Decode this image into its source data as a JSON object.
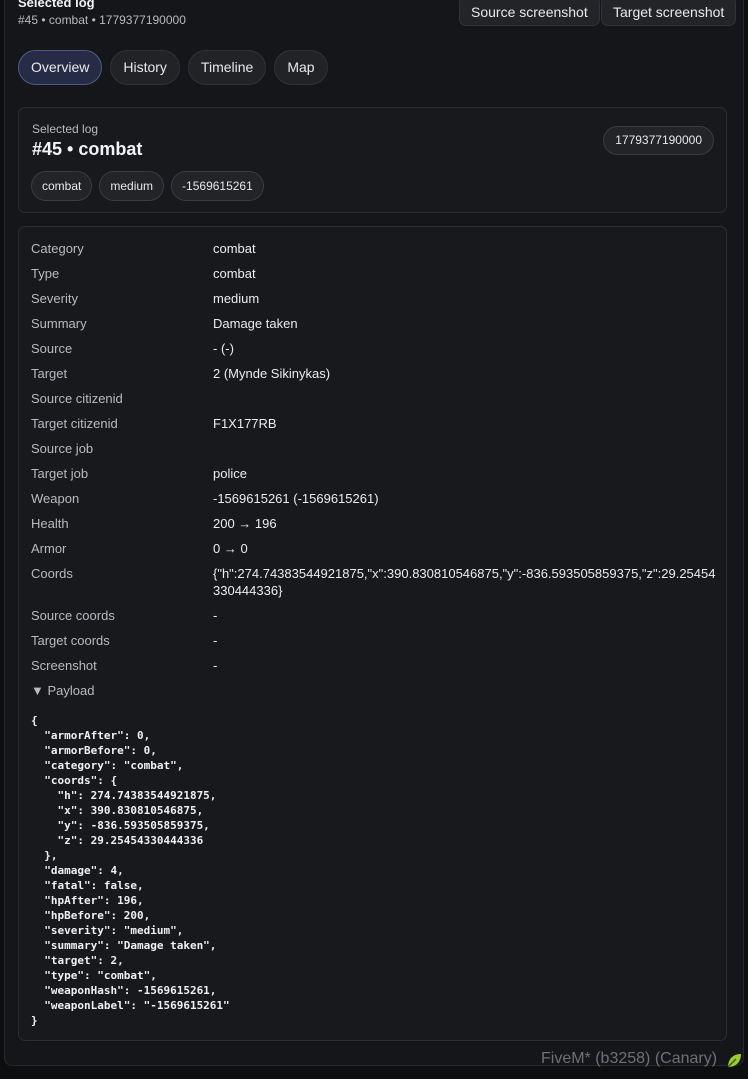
{
  "header": {
    "title": "Selected log",
    "subtitle": "#45 • combat • 1779377190000",
    "source_screenshot_label": "Source screenshot",
    "target_screenshot_label": "Target screenshot"
  },
  "tabs": [
    {
      "label": "Overview",
      "active": true
    },
    {
      "label": "History",
      "active": false
    },
    {
      "label": "Timeline",
      "active": false
    },
    {
      "label": "Map",
      "active": false
    }
  ],
  "selected": {
    "caption": "Selected log",
    "title": "#45 • combat",
    "timestamp": "1779377190000",
    "chips": [
      "combat",
      "medium",
      "-1569615261"
    ]
  },
  "details": [
    {
      "key": "Category",
      "value": "combat"
    },
    {
      "key": "Type",
      "value": "combat"
    },
    {
      "key": "Severity",
      "value": "medium"
    },
    {
      "key": "Summary",
      "value": "Damage taken"
    },
    {
      "key": "Source",
      "value": "- (-)"
    },
    {
      "key": "Target",
      "value": "2 (Mynde Sikinykas)"
    },
    {
      "key": "Source citizenid",
      "value": ""
    },
    {
      "key": "Target citizenid",
      "value": "F1X177RB"
    },
    {
      "key": "Source job",
      "value": ""
    },
    {
      "key": "Target job",
      "value": "police"
    },
    {
      "key": "Weapon",
      "value": "-1569615261 (-1569615261)"
    },
    {
      "key": "Health",
      "value": "200 → 196"
    },
    {
      "key": "Armor",
      "value": "0 → 0"
    },
    {
      "key": "Coords",
      "value": "{\"h\":274.74383544921875,\"x\":390.830810546875,\"y\":-836.593505859375,\"z\":29.25454330444336}"
    },
    {
      "key": "Source coords",
      "value": "-"
    },
    {
      "key": "Target coords",
      "value": "-"
    },
    {
      "key": "Screenshot",
      "value": "-"
    }
  ],
  "payload": {
    "toggle_label": "▼ Payload",
    "json_text": "{\n  \"armorAfter\": 0,\n  \"armorBefore\": 0,\n  \"category\": \"combat\",\n  \"coords\": {\n    \"h\": 274.74383544921875,\n    \"x\": 390.830810546875,\n    \"y\": -836.593505859375,\n    \"z\": 29.25454330444336\n  },\n  \"damage\": 4,\n  \"fatal\": false,\n  \"hpAfter\": 196,\n  \"hpBefore\": 200,\n  \"severity\": \"medium\",\n  \"summary\": \"Damage taken\",\n  \"target\": 2,\n  \"type\": \"combat\",\n  \"weaponHash\": -1569615261,\n  \"weaponLabel\": \"-1569615261\"\n}"
  },
  "footer": {
    "build_label": "FiveM* (b3258) (Canary)",
    "icon": "fivem-leaf-icon",
    "accent_color": "#9acd32"
  }
}
